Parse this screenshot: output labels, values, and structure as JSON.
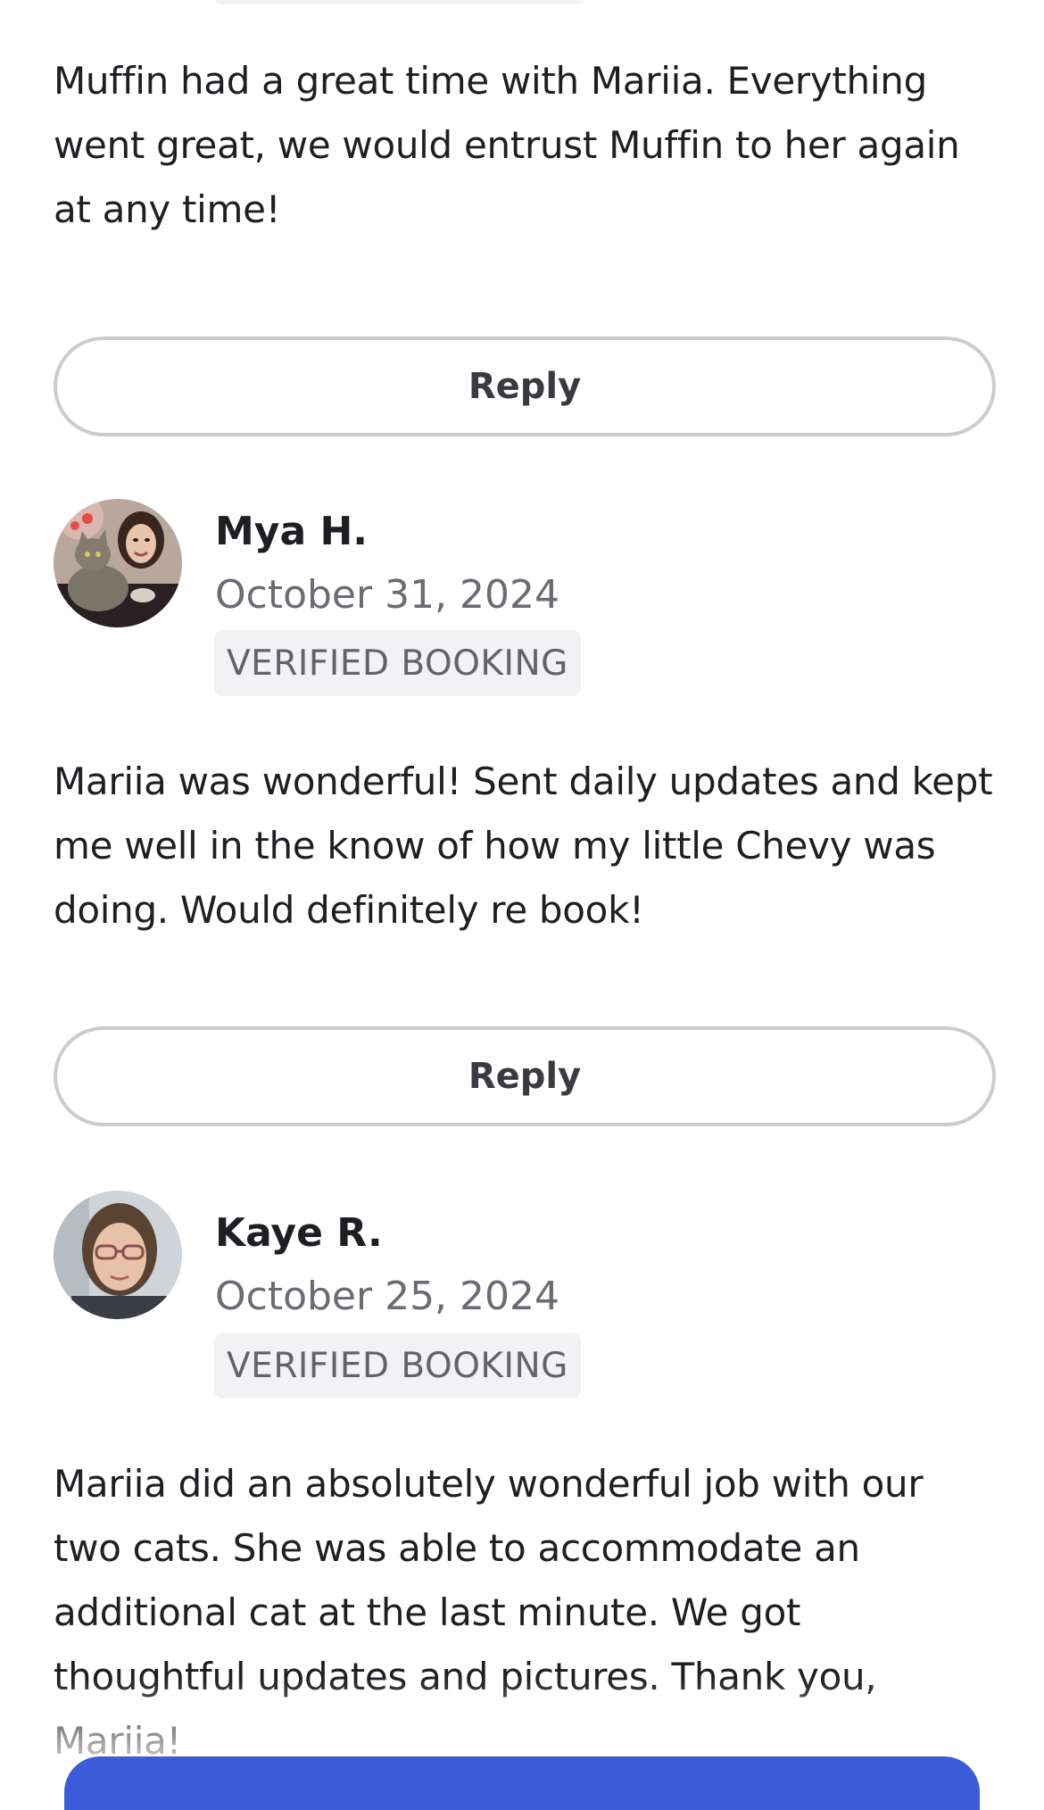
{
  "reviews": [
    {
      "text": "Muffin had a great time with Mariia. Everything went great, we would entrust Muffin to her again at any time!",
      "reply_label": "Reply"
    },
    {
      "name": "Mya H.",
      "date": "October 31, 2024",
      "badge": "VERIFIED BOOKING",
      "text": "Mariia was wonderful! Sent daily updates and kept me well in the know of how my little Chevy was doing. Would definitely re book!",
      "reply_label": "Reply"
    },
    {
      "name": "Kaye R.",
      "date": "October 25, 2024",
      "badge": "VERIFIED BOOKING",
      "text": "Mariia did an absolutely wonderful job with our two cats. She was able to accommodate an additional cat at the last minute. We got thoughtful updates and pictures. Thank you, Mariia!"
    }
  ],
  "colors": {
    "primary_button": "#3b5bd9",
    "badge_bg": "#f2f2f4",
    "muted_text": "#6b6b73"
  }
}
